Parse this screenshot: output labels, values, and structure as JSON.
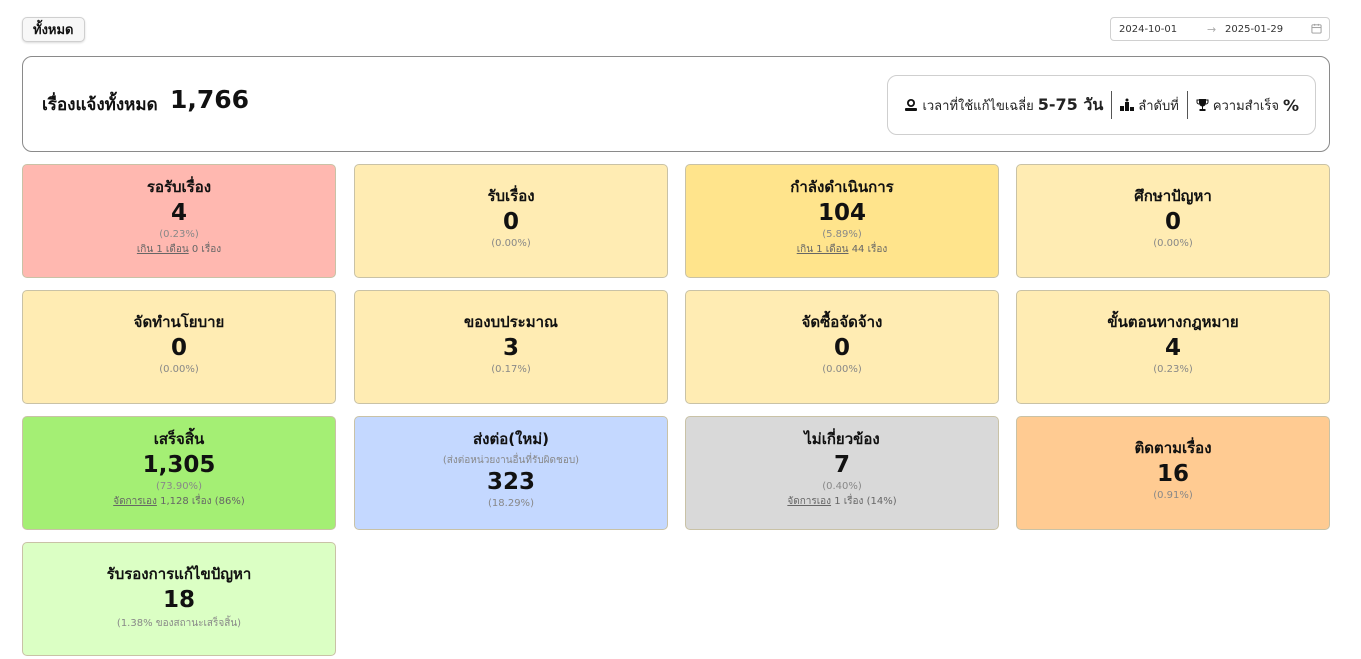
{
  "filter": {
    "label": "ทั้งหมด"
  },
  "date_range": {
    "start": "2024-10-01",
    "arrow": "→",
    "end": "2025-01-29"
  },
  "summary": {
    "label": "เรื่องแจ้งทั้งหมด",
    "total": "1,766",
    "avg_time_label": "เวลาที่ใช้แก้ไขเฉลี่ย",
    "avg_time_value": "5-75 วัน",
    "rank_label": "ลำดับที่",
    "success_label": "ความสำเร็จ",
    "success_value": "%"
  },
  "colors": {
    "red": "#ffb8b0",
    "yellow": "#ffecb3",
    "yellow_strong": "#ffe48c",
    "green": "#a4ef74",
    "blue": "#c4d8ff",
    "gray": "#d9d9d9",
    "orange": "#ffcb92",
    "light_green": "#dbffc4"
  },
  "cards": [
    {
      "title": "รอรับเรื่อง",
      "value": "4",
      "pct": "(0.23%)",
      "note_link": "เกิน 1 เดือน",
      "note_text": " 0 เรื่อง"
    },
    {
      "title": "รับเรื่อง",
      "value": "0",
      "pct": "(0.00%)"
    },
    {
      "title": "กำลังดำเนินการ",
      "value": "104",
      "pct": "(5.89%)",
      "note_link": "เกิน 1 เดือน",
      "note_text": " 44 เรื่อง"
    },
    {
      "title": "ศึกษาปัญหา",
      "value": "0",
      "pct": "(0.00%)"
    },
    {
      "title": "จัดทำนโยบาย",
      "value": "0",
      "pct": "(0.00%)"
    },
    {
      "title": "ของบประมาณ",
      "value": "3",
      "pct": "(0.17%)"
    },
    {
      "title": "จัดซื้อจัดจ้าง",
      "value": "0",
      "pct": "(0.00%)"
    },
    {
      "title": "ขั้นตอนทางกฎหมาย",
      "value": "4",
      "pct": "(0.23%)"
    },
    {
      "title": "เสร็จสิ้น",
      "value": "1,305",
      "pct": "(73.90%)",
      "note_link": "จัดการเอง",
      "note_text": " 1,128 เรื่อง (86%)"
    },
    {
      "title": "ส่งต่อ(ใหม่)",
      "sub": "(ส่งต่อหน่วยงานอื่นที่รับผิดชอบ)",
      "value": "323",
      "pct": "(18.29%)"
    },
    {
      "title": "ไม่เกี่ยวข้อง",
      "value": "7",
      "pct": "(0.40%)",
      "note_link": "จัดการเอง",
      "note_text": " 1 เรื่อง (14%)"
    },
    {
      "title": "ติดตามเรื่อง",
      "value": "16",
      "pct": "(0.91%)"
    },
    {
      "title": "รับรองการแก้ไขปัญหา",
      "value": "18",
      "pct": "(1.38% ของสถานะเสร็จสิ้น)"
    }
  ]
}
